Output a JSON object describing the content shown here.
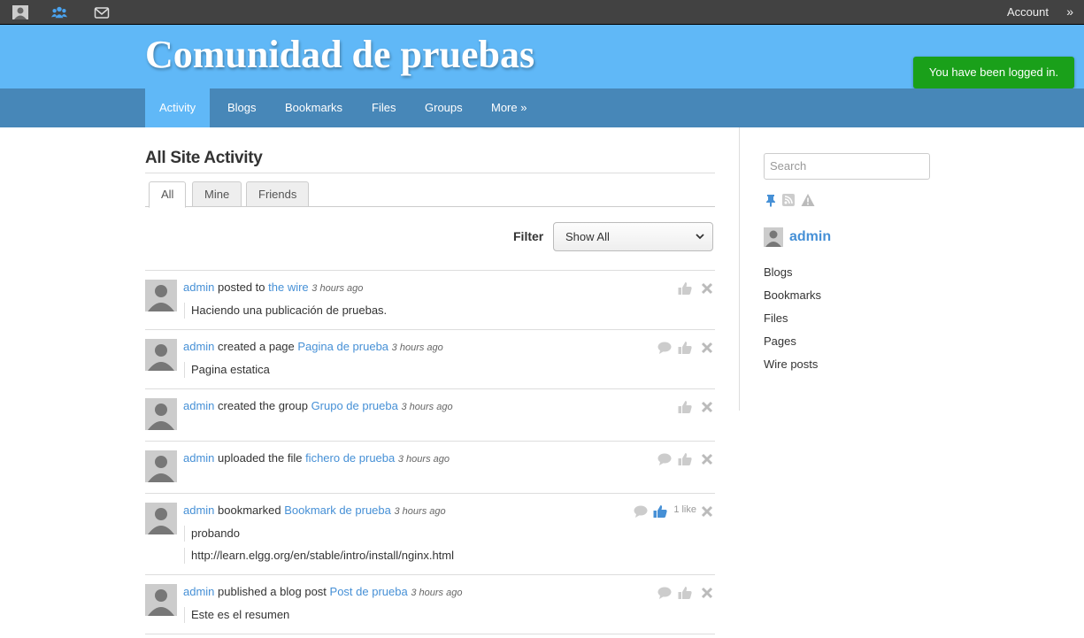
{
  "topbar": {
    "icons": [
      "avatar-icon",
      "friends-icon",
      "messages-icon"
    ],
    "account_label": "Account",
    "account_arrow": "»"
  },
  "header": {
    "site_title": "Comunidad de pruebas",
    "system_message": "You have been logged in."
  },
  "nav": {
    "items": [
      {
        "label": "Activity",
        "active": true
      },
      {
        "label": "Blogs"
      },
      {
        "label": "Bookmarks"
      },
      {
        "label": "Files"
      },
      {
        "label": "Groups"
      },
      {
        "label": "More »"
      }
    ]
  },
  "main": {
    "title": "All Site Activity",
    "tabs": [
      {
        "label": "All",
        "active": true
      },
      {
        "label": "Mine"
      },
      {
        "label": "Friends"
      }
    ],
    "filter_label": "Filter",
    "filter_value": "Show All",
    "activity": [
      {
        "subject": "admin",
        "verb": " posted to ",
        "object": "the wire",
        "time": "3 hours ago",
        "excerpt": "Haciendo una publicación de pruebas.",
        "link": "",
        "comment": false,
        "liked": false,
        "likes": ""
      },
      {
        "subject": "admin",
        "verb": " created a page ",
        "object": "Pagina de prueba",
        "time": "3 hours ago",
        "excerpt": "Pagina estatica",
        "link": "",
        "comment": true,
        "liked": false,
        "likes": ""
      },
      {
        "subject": "admin",
        "verb": " created the group ",
        "object": "Grupo de prueba",
        "time": "3 hours ago",
        "excerpt": "",
        "link": "",
        "comment": false,
        "liked": false,
        "likes": ""
      },
      {
        "subject": "admin",
        "verb": " uploaded the file ",
        "object": "fichero de prueba",
        "time": "3 hours ago",
        "excerpt": "",
        "link": "",
        "comment": true,
        "liked": false,
        "likes": ""
      },
      {
        "subject": "admin",
        "verb": " bookmarked ",
        "object": "Bookmark de prueba",
        "time": "3 hours ago",
        "excerpt": "probando",
        "link": "http://learn.elgg.org/en/stable/intro/install/nginx.html",
        "comment": true,
        "liked": true,
        "likes": "1 like"
      },
      {
        "subject": "admin",
        "verb": " published a blog post ",
        "object": "Post de prueba",
        "time": "3 hours ago",
        "excerpt": "Este es el resumen",
        "link": "",
        "comment": true,
        "liked": false,
        "likes": ""
      }
    ]
  },
  "sidebar": {
    "search_placeholder": "Search",
    "icons": [
      "pin-icon",
      "rss-icon",
      "report-icon"
    ],
    "owner_name": "admin",
    "links": [
      "Blogs",
      "Bookmarks",
      "Files",
      "Pages",
      "Wire posts"
    ]
  },
  "colors": {
    "topbar": "#424242",
    "header": "#60b8f7",
    "nav": "#4787b8",
    "link": "#4690d6",
    "message": "#1aa01a"
  }
}
